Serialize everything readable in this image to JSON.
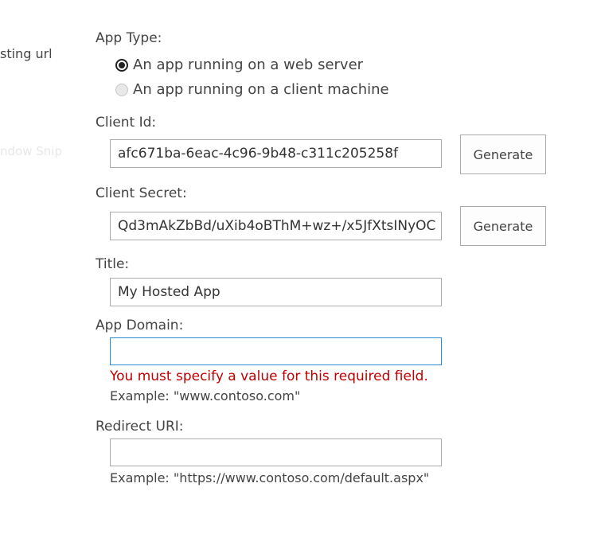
{
  "left_fragment": "sting url",
  "ghost_fragment": "ndow Snip",
  "app_type": {
    "label": "App Type:",
    "options": [
      {
        "label": "An app running on a web server",
        "checked": true
      },
      {
        "label": "An app running on a client machine",
        "checked": false
      }
    ]
  },
  "client_id": {
    "label": "Client Id:",
    "value": "afc671ba-6eac-4c96-9b48-c311c205258f",
    "generate_label": "Generate"
  },
  "client_secret": {
    "label": "Client Secret:",
    "value": "Qd3mAkZbBd/uXib4oBThM+wz+/x5JfXtsINyOC",
    "generate_label": "Generate"
  },
  "title": {
    "label": "Title:",
    "value": "My Hosted App"
  },
  "app_domain": {
    "label": "App Domain:",
    "value": "",
    "error": "You must specify a value for this required field.",
    "example": "Example: \"www.contoso.com\""
  },
  "redirect_uri": {
    "label": "Redirect URI:",
    "value": "",
    "example": "Example: \"https://www.contoso.com/default.aspx\""
  },
  "colors": {
    "error": "#c00000",
    "focus_border": "#2a8dd4",
    "text": "#444444",
    "border": "#ababab"
  }
}
